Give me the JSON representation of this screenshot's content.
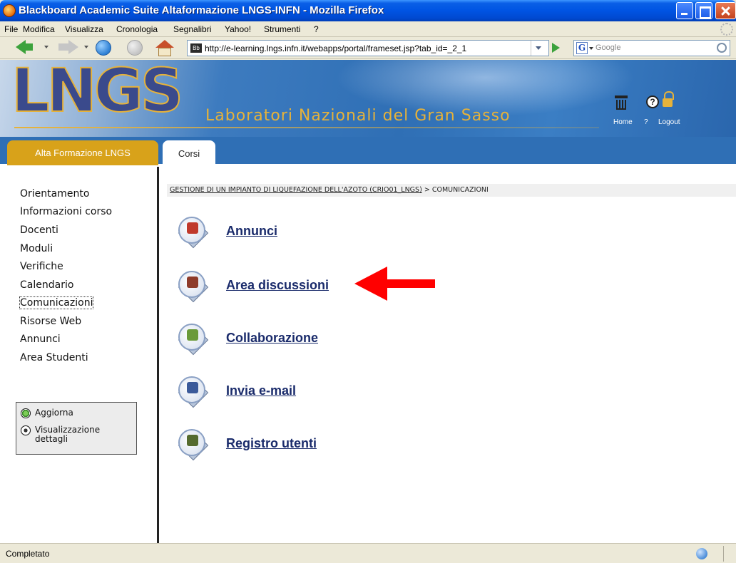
{
  "window": {
    "title": "Blackboard Academic Suite Altaformazione LNGS-INFN - Mozilla Firefox"
  },
  "menu": {
    "items": [
      "File",
      "Modifica",
      "Visualizza",
      "Cronologia",
      "Segnalibri",
      "Yahoo!",
      "Strumenti",
      "?"
    ]
  },
  "nav": {
    "url": "http://e-learning.lngs.infn.it/webapps/portal/frameset.jsp?tab_id=_2_1",
    "favicon_text": "Bb",
    "search_placeholder": "Google",
    "search_engine_letter": "G"
  },
  "banner": {
    "logo": "LNGS",
    "tagline": "Laboratori Nazionali del Gran Sasso",
    "home_label": "Home",
    "help_label": "?",
    "logout_label": "Logout"
  },
  "tabs": {
    "institution": "Alta Formazione LNGS",
    "courses": "Corsi"
  },
  "sidebar": {
    "items": [
      {
        "label": "Orientamento",
        "selected": false
      },
      {
        "label": "Informazioni corso",
        "selected": false
      },
      {
        "label": "Docenti",
        "selected": false
      },
      {
        "label": "Moduli",
        "selected": false
      },
      {
        "label": "Verifiche",
        "selected": false
      },
      {
        "label": "Calendario",
        "selected": false
      },
      {
        "label": "Comunicazioni",
        "selected": true
      },
      {
        "label": "Risorse Web",
        "selected": false
      },
      {
        "label": "Annunci",
        "selected": false
      },
      {
        "label": "Area Studenti",
        "selected": false
      }
    ],
    "toolbox": {
      "refresh": "Aggiorna",
      "details_line1": "Visualizzazione",
      "details_line2": "dettagli"
    }
  },
  "breadcrumb": {
    "course": "GESTIONE DI UN IMPIANTO DI LIQUEFAZIONE DELL'AZOTO (CRIO01_LNGS)",
    "separator": ">",
    "current": "COMUNICAZIONI"
  },
  "tools": [
    {
      "label": "Annunci",
      "icon": "announcements-icon",
      "color": "#c0392b"
    },
    {
      "label": "Area discussioni",
      "icon": "discussion-board-icon",
      "color": "#8e3b2a"
    },
    {
      "label": "Collaborazione",
      "icon": "collaboration-icon",
      "color": "#6a9a3a"
    },
    {
      "label": "Invia e-mail",
      "icon": "send-email-icon",
      "color": "#3b5a9a"
    },
    {
      "label": "Registro utenti",
      "icon": "user-roster-icon",
      "color": "#556b2f"
    }
  ],
  "status": {
    "text": "Completato"
  },
  "colors": {
    "title_bar": "#0054e3",
    "banner_blue": "#2f6fb5",
    "tab_gold": "#d8a21a",
    "link_navy": "#1a2b6b",
    "annotation_red": "#ff0000"
  }
}
